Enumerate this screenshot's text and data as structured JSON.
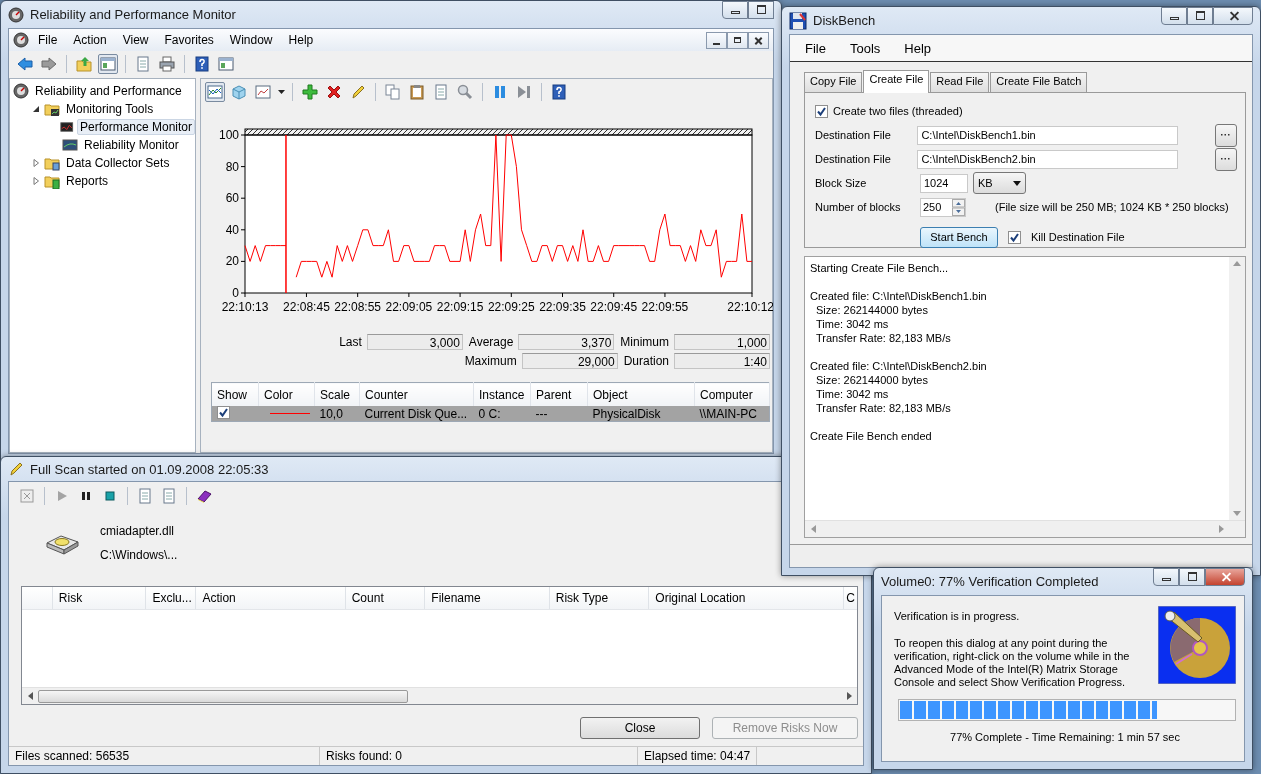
{
  "perfmon_window": {
    "title": "Reliability and Performance Monitor",
    "menu": [
      "File",
      "Action",
      "View",
      "Favorites",
      "Window",
      "Help"
    ],
    "tree": {
      "root": {
        "label": "Reliability and Performance",
        "children": [
          {
            "label": "Monitoring Tools",
            "kind": "tools",
            "expanded": true,
            "selected": false,
            "children": [
              {
                "label": "Performance Monitor",
                "kind": "performance",
                "selected": true
              },
              {
                "label": "Reliability Monitor",
                "kind": "reliability",
                "selected": false
              }
            ]
          },
          {
            "label": "Data Collector Sets",
            "kind": "collector",
            "expanded": false,
            "selected": false
          },
          {
            "label": "Reports",
            "kind": "reports",
            "expanded": false,
            "selected": false
          }
        ]
      }
    },
    "chart_data": {
      "type": "line",
      "categories": [
        "22:10:13",
        null,
        null,
        null,
        null,
        null,
        null,
        null,
        null,
        null,
        null,
        null,
        "22:08:45",
        null,
        null,
        null,
        null,
        null,
        null,
        null,
        null,
        null,
        "22:08:55",
        null,
        null,
        null,
        null,
        null,
        null,
        null,
        null,
        null,
        "22:09:05",
        null,
        null,
        null,
        null,
        null,
        null,
        null,
        null,
        null,
        "22:09:15",
        null,
        null,
        null,
        null,
        null,
        null,
        null,
        null,
        null,
        "22:09:25",
        null,
        null,
        null,
        null,
        null,
        null,
        null,
        null,
        null,
        "22:09:35",
        null,
        null,
        null,
        null,
        null,
        null,
        null,
        null,
        null,
        "22:09:45",
        null,
        null,
        null,
        null,
        null,
        null,
        null,
        null,
        null,
        "22:09:55",
        null,
        null,
        null,
        null,
        null,
        null,
        null,
        null,
        null,
        null,
        null,
        null,
        null,
        null,
        null,
        null,
        "22:10:12"
      ],
      "ylim": [
        0,
        100
      ],
      "yticks": [
        0,
        20,
        40,
        60,
        80,
        100
      ],
      "series": [
        {
          "color": "#ff0000",
          "values": [
            30,
            20,
            30,
            20,
            30,
            30,
            30,
            30,
            30,
            null,
            10,
            20,
            20,
            20,
            20,
            10,
            20,
            10,
            30,
            20,
            30,
            20,
            30,
            40,
            40,
            30,
            30,
            30,
            40,
            20,
            20,
            30,
            30,
            20,
            20,
            20,
            20,
            30,
            30,
            30,
            20,
            20,
            20,
            40,
            20,
            40,
            50,
            30,
            30,
            100,
            20,
            100,
            100,
            80,
            40,
            30,
            20,
            20,
            30,
            30,
            20,
            30,
            30,
            20,
            30,
            20,
            40,
            20,
            20,
            30,
            20,
            20,
            30,
            30,
            30,
            30,
            30,
            30,
            30,
            20,
            20,
            40,
            50,
            30,
            30,
            30,
            20,
            30,
            20,
            40,
            30,
            30,
            40,
            10,
            20,
            20,
            20,
            50,
            20,
            20
          ]
        }
      ]
    },
    "stats_rows": [
      {
        "items": [
          {
            "label": "Last",
            "value": "3,000"
          },
          {
            "label": "Average",
            "value": "3,370"
          },
          {
            "label": "Minimum",
            "value": "1,000"
          }
        ]
      },
      {
        "items": [
          {
            "label": "Maximum",
            "value": "29,000"
          },
          {
            "label": "Duration",
            "value": "1:40"
          }
        ]
      }
    ],
    "counter_table": {
      "columns": [
        "Show",
        "Color",
        "Scale",
        "Counter",
        "Instance",
        "Parent",
        "Object",
        "Computer"
      ],
      "rows": [
        {
          "show": true,
          "selected": true,
          "color": "#ff0000",
          "cells": [
            "",
            "",
            "10,0",
            "Current Disk Que...",
            "0 C:",
            "---",
            "PhysicalDisk",
            "\\\\MAIN-PC"
          ]
        }
      ]
    }
  },
  "scan_window": {
    "title": "Full Scan started on 01.09.2008 22:05:33",
    "current_file": "cmiadapter.dll",
    "current_path": "C:\\Windows\\...",
    "table": {
      "columns": [
        "Risk",
        "Exclu...",
        "Action",
        "Count",
        "Filename",
        "Risk Type",
        "Original Location",
        "C"
      ]
    },
    "buttons": [
      {
        "label": "Close",
        "disabled": false
      },
      {
        "label": "Remove Risks Now",
        "disabled": true
      }
    ],
    "status_bar": [
      "Files scanned: 56535",
      "Risks found: 0",
      "Elapsed time: 04:47"
    ]
  },
  "diskbench_window": {
    "title": "DiskBench",
    "menu": [
      "File",
      "Tools",
      "Help"
    ],
    "tabs": [
      {
        "label": "Copy File",
        "selected": false
      },
      {
        "label": "Create File",
        "selected": true
      },
      {
        "label": "Read File",
        "selected": false
      },
      {
        "label": "Create File Batch",
        "selected": false
      }
    ],
    "create_two_files": {
      "label": "Create two files (threaded)",
      "checked": true
    },
    "destination_files": [
      {
        "label": "Destination File",
        "value": "C:\\Intel\\DiskBench1.bin"
      },
      {
        "label": "Destination File",
        "value": "C:\\Intel\\DiskBench2.bin"
      }
    ],
    "block_size": {
      "label": "Block Size",
      "value": "1024",
      "unit": "KB"
    },
    "number_of_blocks": {
      "label": "Number of blocks",
      "value": "250"
    },
    "file_size_note": "(File size will be 250 MB; 1024 KB * 250 blocks)",
    "start_button": "Start Bench",
    "kill_destination": {
      "label": "Kill Destination File",
      "checked": true
    },
    "log": [
      {
        "heading": "Starting Create File Bench..."
      },
      {
        "heading": "Created file: C:\\Intel\\DiskBench1.bin",
        "details": [
          "Size: 262144000 bytes",
          "Time: 3042 ms",
          "Transfer Rate: 82,183 MB/s"
        ]
      },
      {
        "heading": "Created file: C:\\Intel\\DiskBench2.bin",
        "details": [
          "Size: 262144000 bytes",
          "Time: 3042 ms",
          "Transfer Rate: 82,183 MB/s"
        ]
      },
      {
        "heading": "Create File Bench ended"
      }
    ]
  },
  "verification_dialog": {
    "title": "Volume0: 77% Verification Completed",
    "message": "Verification is in progress.",
    "details": "To reopen this dialog at any point during the verification, right-click on the volume while in the Advanced Mode of the Intel(R) Matrix Storage Console and select Show Verification Progress.",
    "progress": {
      "level": 0.77
    },
    "status": "77% Complete - Time Remaining: 1 min 57 sec"
  }
}
